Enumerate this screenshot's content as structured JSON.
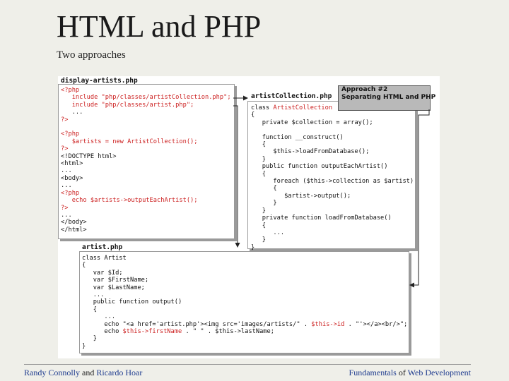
{
  "slide": {
    "title": "HTML and PHP",
    "subtitle": "Two approaches"
  },
  "diagram": {
    "approach_label_line1": "Approach #2",
    "approach_label_line2": "Separating HTML and PHP",
    "display_file": {
      "name": "display-artists.php",
      "lines": [
        {
          "text": "<?php",
          "red": true
        },
        {
          "text": "   include \"php/classes/artistCollection.php\";",
          "red": true
        },
        {
          "text": "   include \"php/classes/artist.php\";",
          "red": true
        },
        {
          "text": "   ...",
          "red": false
        },
        {
          "text": "?>",
          "red": true
        },
        {
          "text": "",
          "red": false
        },
        {
          "text": "<?php",
          "red": true
        },
        {
          "text": "   $artists = new ArtistCollection();",
          "red": true
        },
        {
          "text": "?>",
          "red": true
        },
        {
          "text": "<!DOCTYPE html>",
          "red": false
        },
        {
          "text": "<html>",
          "red": false
        },
        {
          "text": "...",
          "red": false
        },
        {
          "text": "<body>",
          "red": false
        },
        {
          "text": "...",
          "red": false
        },
        {
          "text": "<?php",
          "red": true
        },
        {
          "text": "   echo $artists->outputEachArtist();",
          "red": true
        },
        {
          "text": "?>",
          "red": true
        },
        {
          "text": "...",
          "red": false
        },
        {
          "text": "</body>",
          "red": false
        },
        {
          "text": "</html>",
          "red": false
        }
      ]
    },
    "collection_file": {
      "name": "artistCollection.php",
      "lines": [
        "class ArtistCollection",
        "{",
        "   private $collection = array();",
        "",
        "   function __construct()",
        "   {",
        "      $this->loadFromDatabase();",
        "   }",
        "   public function outputEachArtist()",
        "   {",
        "      foreach ($this->collection as $artist)",
        "      {",
        "         $artist->output();",
        "      }",
        "   }",
        "   private function loadFromDatabase()",
        "   {",
        "      ...",
        "   }",
        "}"
      ]
    },
    "artist_file": {
      "name": "artist.php",
      "lines": [
        "class Artist",
        "{",
        "   var $Id;",
        "   var $FirstName;",
        "   var $LastName;",
        "   ...",
        "   public function output()",
        "   {",
        "      ...",
        "      echo \"<a href='artist.php'><img src='images/artists/\" . $this->id . \"'></a><br/>\";",
        "      echo $this->firstName . \" \" . $this->lastName;",
        "   }",
        "}"
      ]
    }
  },
  "footer": {
    "author1": "Randy Connolly",
    "and": "and",
    "author2": "Ricardo Hoar",
    "book_part1": "Fundamentals",
    "of": "of",
    "book_part2": "Web Development"
  }
}
